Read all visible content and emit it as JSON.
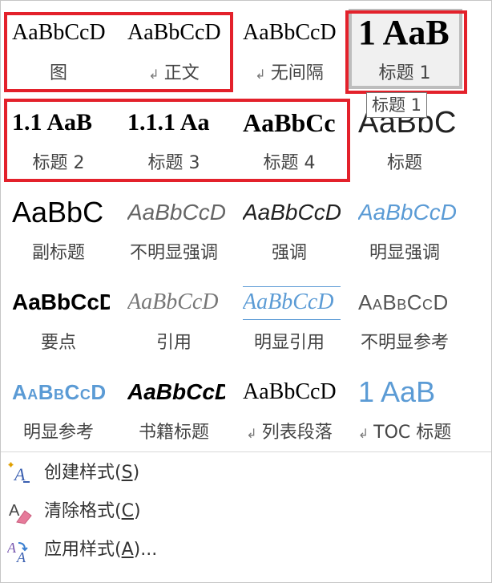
{
  "styles": [
    {
      "id": "fig",
      "sample": "AaBbCcD",
      "label": "图",
      "arrow": false
    },
    {
      "id": "body",
      "sample": "AaBbCcD",
      "label": "正文",
      "arrow": true
    },
    {
      "id": "nospace",
      "sample": "AaBbCcD",
      "label": "无间隔",
      "arrow": true
    },
    {
      "id": "h1",
      "sample": "1  AaB",
      "label": "标题 1",
      "arrow": false,
      "selected": true
    },
    {
      "id": "h2",
      "sample": "1.1  AaB",
      "label": "标题 2",
      "arrow": false
    },
    {
      "id": "h3",
      "sample": "1.1.1  Aa",
      "label": "标题 3",
      "arrow": false
    },
    {
      "id": "h4",
      "sample": "AaBbCc",
      "label": "标题 4",
      "arrow": false
    },
    {
      "id": "title",
      "sample": "AaBbC",
      "label": "标题",
      "arrow": false
    },
    {
      "id": "subtitle",
      "sample": "AaBbC",
      "label": "副标题",
      "arrow": false
    },
    {
      "id": "subemph",
      "sample": "AaBbCcD",
      "label": "不明显强调",
      "arrow": false
    },
    {
      "id": "emph",
      "sample": "AaBbCcD",
      "label": "强调",
      "arrow": false
    },
    {
      "id": "intemph",
      "sample": "AaBbCcD",
      "label": "明显强调",
      "arrow": false
    },
    {
      "id": "strong",
      "sample": "AaBbCcD",
      "label": "要点",
      "arrow": false
    },
    {
      "id": "quote",
      "sample": "AaBbCcD",
      "label": "引用",
      "arrow": false
    },
    {
      "id": "intquote",
      "sample": "AaBbCcD",
      "label": "明显引用",
      "arrow": false
    },
    {
      "id": "subref",
      "sample": "AaBbCcD",
      "label": "不明显参考",
      "arrow": false
    },
    {
      "id": "intref",
      "sample": "AaBbCcD",
      "label": "明显参考",
      "arrow": false
    },
    {
      "id": "book",
      "sample": "AaBbCcD",
      "label": "书籍标题",
      "arrow": false
    },
    {
      "id": "list",
      "sample": "AaBbCcD",
      "label": "列表段落",
      "arrow": true
    },
    {
      "id": "toc",
      "sample": "1  AaB",
      "label": "TOC 标题",
      "arrow": true
    }
  ],
  "tooltip": "标题 1",
  "menu": [
    {
      "id": "create",
      "text": "创建样式(",
      "key": "S",
      "end": ")",
      "icon": "create-style-icon"
    },
    {
      "id": "clear",
      "text": "清除格式(",
      "key": "C",
      "end": ")",
      "icon": "clear-formatting-icon"
    },
    {
      "id": "apply",
      "text": "应用样式(",
      "key": "A",
      "end": ")...",
      "icon": "apply-styles-icon"
    }
  ],
  "colors": {
    "highlight": "#e3212b",
    "accent": "#5b9bd5"
  }
}
